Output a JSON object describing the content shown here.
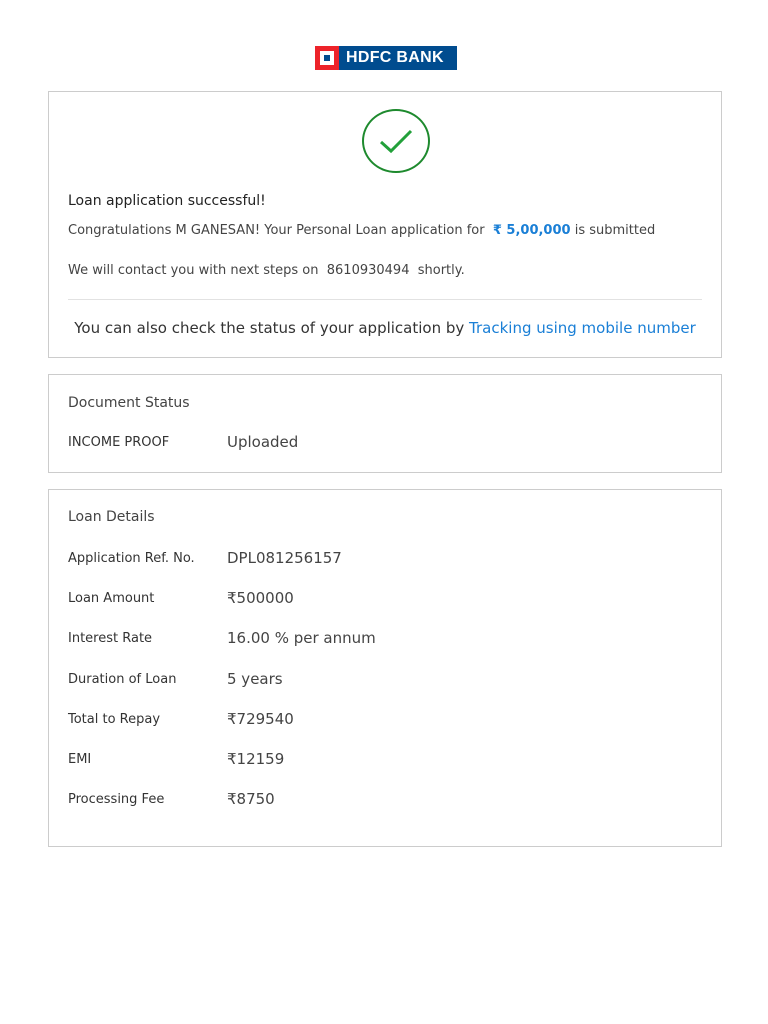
{
  "logo": {
    "text": "HDFC BANK"
  },
  "success": {
    "title": "Loan application successful!",
    "congrats_prefix": "Congratulations M GANESAN! Your Personal Loan application for",
    "amount": "₹ 5,00,000",
    "congrats_suffix": "is submitted",
    "contact_prefix": "We will contact you with next steps on",
    "phone": "8610930494",
    "contact_suffix": "shortly.",
    "track_prefix": "You can also check the status of your application by",
    "track_link": "Tracking using mobile number"
  },
  "documents": {
    "title": "Document Status",
    "items": [
      {
        "label": "INCOME PROOF",
        "value": "Uploaded"
      }
    ]
  },
  "loan": {
    "title": "Loan Details",
    "rows": [
      {
        "label": "Application Ref. No.",
        "value": "DPL081256157"
      },
      {
        "label": "Loan Amount",
        "value": "₹500000"
      },
      {
        "label": "Interest Rate",
        "value": "16.00 % per annum"
      },
      {
        "label": "Duration of Loan",
        "value": "5 years"
      },
      {
        "label": "Total to Repay",
        "value": "₹729540"
      },
      {
        "label": "EMI",
        "value": "₹12159"
      },
      {
        "label": "Processing Fee",
        "value": "₹8750"
      }
    ]
  }
}
